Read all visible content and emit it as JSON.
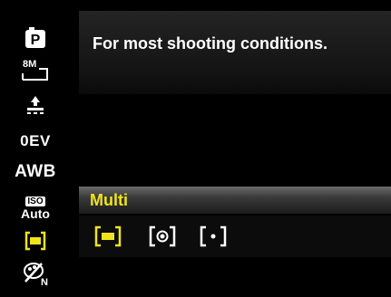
{
  "colors": {
    "selected": "#f0e31c",
    "text": "#ffffff",
    "background": "#000000"
  },
  "sidebar": {
    "items": [
      {
        "icon": "program-mode-icon"
      },
      {
        "icon": "resolution-8m-icon"
      },
      {
        "icon": "quality-icon"
      },
      {
        "label": "0EV"
      },
      {
        "label": "AWB"
      },
      {
        "iso_box": "ISO",
        "iso_value": "Auto"
      },
      {
        "icon": "metering-multi-icon",
        "selected": true
      },
      {
        "icon": "color-effect-icon"
      }
    ]
  },
  "description": {
    "text": "For most shooting conditions."
  },
  "metering": {
    "current_label": "Multi",
    "options": [
      {
        "icon": "metering-multi-icon",
        "selected": true
      },
      {
        "icon": "metering-center-icon",
        "selected": false
      },
      {
        "icon": "metering-spot-icon",
        "selected": false
      }
    ]
  }
}
